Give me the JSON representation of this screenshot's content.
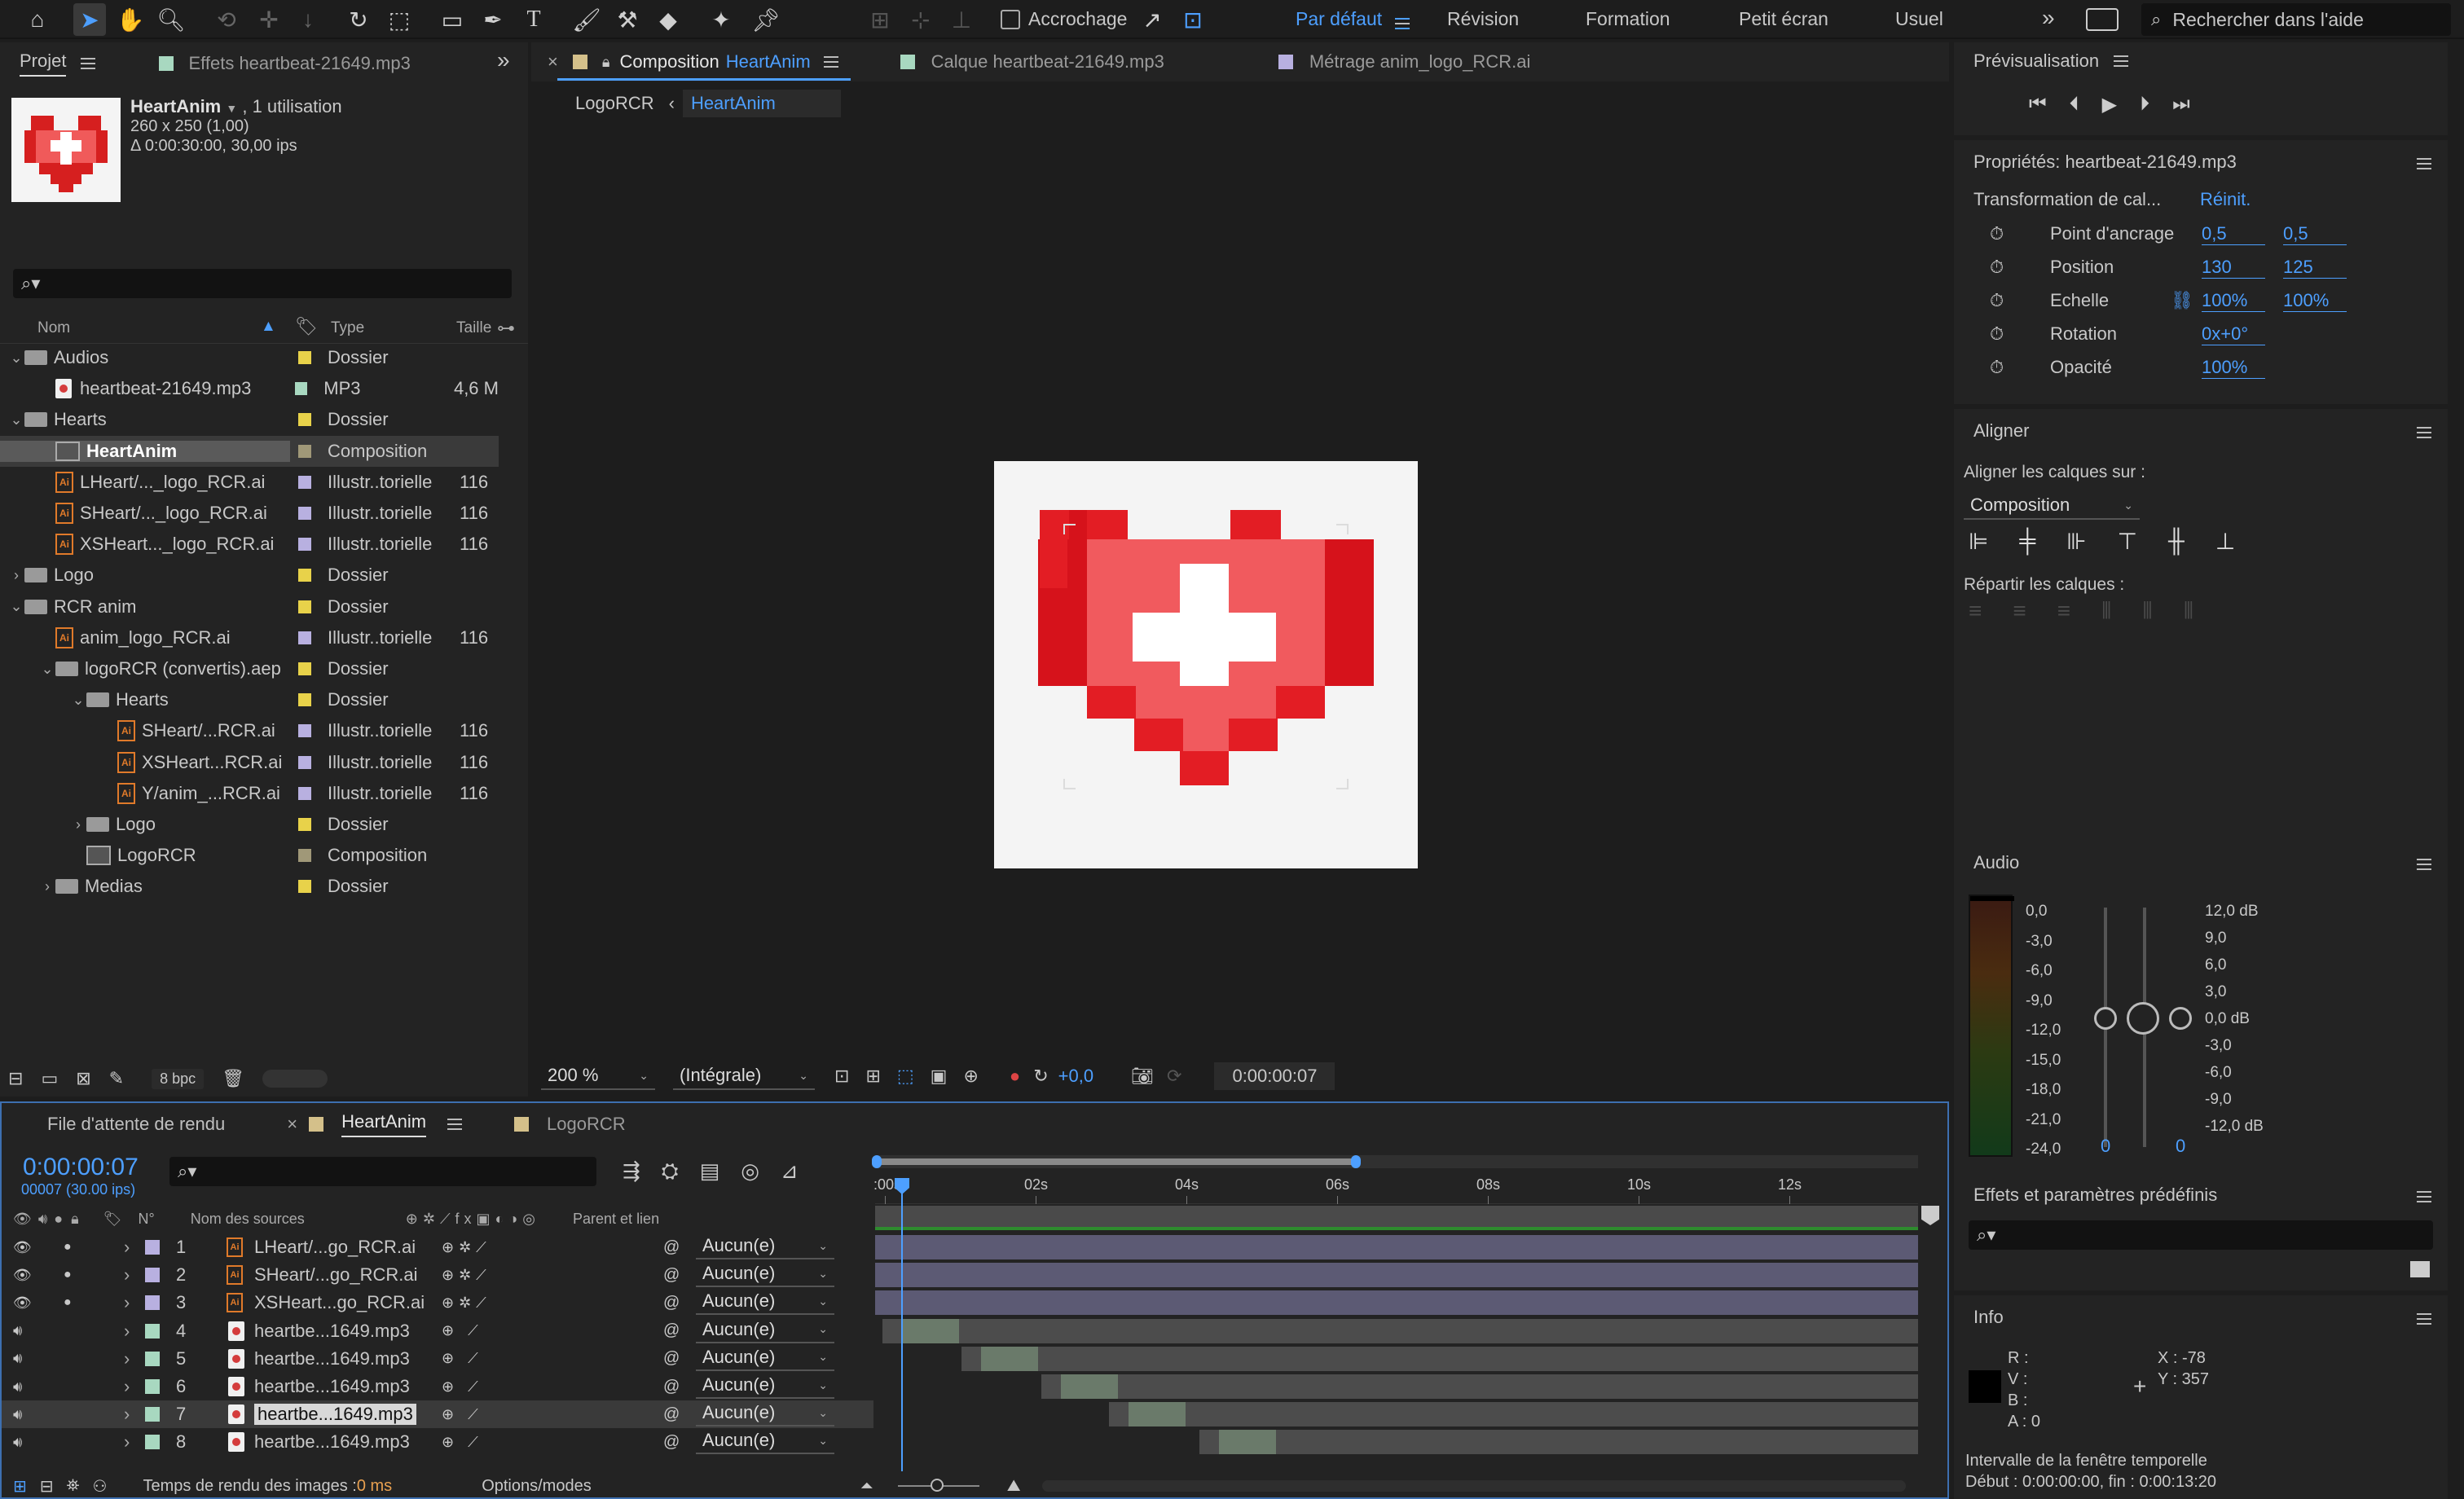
{
  "toolbar": {
    "snapping_label": "Accrochage",
    "workspaces": [
      "Par défaut",
      "Révision",
      "Formation",
      "Petit écran",
      "Usuel"
    ],
    "search_placeholder": "Rechercher dans l'aide"
  },
  "project": {
    "tab_project": "Projet",
    "tab_effects": "Effets heartbeat-21649.mp3",
    "selected_name": "HeartAnim",
    "selected_usage": ", 1 utilisation",
    "selected_size": "260 x 250 (1,00)",
    "selected_duration": "Δ 0:00:30:00, 30,00 ips",
    "col_name": "Nom",
    "col_type": "Type",
    "col_size": "Taille",
    "items": [
      {
        "name": "Audios",
        "type": "Dossier",
        "size": "",
        "kind": "folder",
        "indent": 0,
        "chev": "v"
      },
      {
        "name": "heartbeat-21649.mp3",
        "type": "MP3",
        "size": "4,6 M",
        "kind": "mp3",
        "indent": 1,
        "chev": ""
      },
      {
        "name": "Hearts",
        "type": "Dossier",
        "size": "",
        "kind": "folder",
        "indent": 0,
        "chev": "v"
      },
      {
        "name": "HeartAnim",
        "type": "Composition",
        "size": "",
        "kind": "comp",
        "indent": 1,
        "chev": ""
      },
      {
        "name": "LHeart/..._logo_RCR.ai",
        "type": "Illustr..torielle",
        "size": "116",
        "kind": "ai",
        "indent": 1,
        "chev": ""
      },
      {
        "name": "SHeart/..._logo_RCR.ai",
        "type": "Illustr..torielle",
        "size": "116",
        "kind": "ai",
        "indent": 1,
        "chev": ""
      },
      {
        "name": "XSHeart..._logo_RCR.ai",
        "type": "Illustr..torielle",
        "size": "116",
        "kind": "ai",
        "indent": 1,
        "chev": ""
      },
      {
        "name": "Logo",
        "type": "Dossier",
        "size": "",
        "kind": "folder",
        "indent": 0,
        "chev": ">"
      },
      {
        "name": "RCR anim",
        "type": "Dossier",
        "size": "",
        "kind": "folder",
        "indent": 0,
        "chev": "v"
      },
      {
        "name": "anim_logo_RCR.ai",
        "type": "Illustr..torielle",
        "size": "116",
        "kind": "ai",
        "indent": 1,
        "chev": ""
      },
      {
        "name": "logoRCR (convertis).aep",
        "type": "Dossier",
        "size": "",
        "kind": "folder",
        "indent": 1,
        "chev": "v"
      },
      {
        "name": "Hearts",
        "type": "Dossier",
        "size": "",
        "kind": "folder",
        "indent": 2,
        "chev": "v"
      },
      {
        "name": "SHeart/...RCR.ai",
        "type": "Illustr..torielle",
        "size": "116",
        "kind": "ai",
        "indent": 3,
        "chev": ""
      },
      {
        "name": "XSHeart...RCR.ai",
        "type": "Illustr..torielle",
        "size": "116",
        "kind": "ai",
        "indent": 3,
        "chev": ""
      },
      {
        "name": "Y/anim_...RCR.ai",
        "type": "Illustr..torielle",
        "size": "116",
        "kind": "ai",
        "indent": 3,
        "chev": ""
      },
      {
        "name": "Logo",
        "type": "Dossier",
        "size": "",
        "kind": "folder",
        "indent": 2,
        "chev": ">"
      },
      {
        "name": "LogoRCR",
        "type": "Composition",
        "size": "",
        "kind": "comp",
        "indent": 2,
        "chev": ""
      },
      {
        "name": "Medias",
        "type": "Dossier",
        "size": "",
        "kind": "folder",
        "indent": 1,
        "chev": ">"
      }
    ],
    "bpc": "8 bpc"
  },
  "viewer": {
    "tab_comp_prefix": "Composition",
    "tab_comp_name": "HeartAnim",
    "tab_layer": "Calque heartbeat-21649.mp3",
    "tab_footage": "Métrage anim_logo_RCR.ai",
    "crumb_parent": "LogoRCR",
    "crumb_current": "HeartAnim",
    "zoom": "200 %",
    "resolution": "(Intégrale)",
    "exposure": "+0,0",
    "timecode": "0:00:00:07"
  },
  "preview": {
    "title": "Prévisualisation"
  },
  "properties": {
    "title": "Propriétés: heartbeat-21649.mp3",
    "section": "Transformation de cal...",
    "reset": "Réinit.",
    "rows": [
      {
        "label": "Point d'ancrage",
        "v1": "0,5",
        "v2": "0,5"
      },
      {
        "label": "Position",
        "v1": "130",
        "v2": "125"
      },
      {
        "label": "Echelle",
        "v1": "100%",
        "v2": "100%"
      },
      {
        "label": "Rotation",
        "v1": "0x+0°",
        "v2": ""
      },
      {
        "label": "Opacité",
        "v1": "100%",
        "v2": ""
      }
    ]
  },
  "align": {
    "title": "Aligner",
    "align_to_label": "Aligner les calques sur :",
    "align_to_value": "Composition",
    "distribute_label": "Répartir les calques :"
  },
  "audio": {
    "title": "Audio",
    "left_scale": [
      "0,0",
      "-3,0",
      "-6,0",
      "-9,0",
      "-12,0",
      "-15,0",
      "-18,0",
      "-21,0",
      "-24,0"
    ],
    "right_scale": [
      "12,0 dB",
      "9,0",
      "6,0",
      "3,0",
      "0,0 dB",
      "-3,0",
      "-6,0",
      "-9,0",
      "-12,0 dB"
    ],
    "left_value": "0",
    "right_value": "0"
  },
  "effects": {
    "title": "Effets et paramètres prédéfinis"
  },
  "info": {
    "title": "Info",
    "r": "R :",
    "v": "V :",
    "b": "B :",
    "a": "A :  0",
    "x": "X :  -78",
    "y": "Y :  357",
    "interval_label": "Intervalle de la fenêtre temporelle",
    "interval_value": "Début : 0:00:00:00, fin : 0:00:13:20"
  },
  "timeline": {
    "tab_render": "File d'attente de rendu",
    "tab_heart": "HeartAnim",
    "tab_logo": "LogoRCR",
    "timecode": "0:00:00:07",
    "frames": "00007 (30.00 ips)",
    "col_num": "N°",
    "col_source": "Nom des sources",
    "col_parent": "Parent et lien",
    "ruler": [
      ":00s",
      "02s",
      "04s",
      "06s",
      "08s",
      "10s",
      "12s"
    ],
    "layers": [
      {
        "num": "1",
        "name": "LHeart/...go_RCR.ai",
        "parent": "Aucun(e)",
        "kind": "ai",
        "start": 0.0,
        "end": 14.0
      },
      {
        "num": "2",
        "name": "SHeart/...go_RCR.ai",
        "parent": "Aucun(e)",
        "kind": "ai",
        "start": 0.0,
        "end": 14.0
      },
      {
        "num": "3",
        "name": "XSHeart...go_RCR.ai",
        "parent": "Aucun(e)",
        "kind": "ai",
        "start": 0.0,
        "end": 14.0
      },
      {
        "num": "4",
        "name": "heartbe...1649.mp3",
        "parent": "Aucun(e)",
        "kind": "mp3",
        "start": 0.1,
        "end": 14.0
      },
      {
        "num": "5",
        "name": "heartbe...1649.mp3",
        "parent": "Aucun(e)",
        "kind": "mp3",
        "start": 1.15,
        "end": 14.0
      },
      {
        "num": "6",
        "name": "heartbe...1649.mp3",
        "parent": "Aucun(e)",
        "kind": "mp3",
        "start": 2.2,
        "end": 14.0
      },
      {
        "num": "7",
        "name": "heartbe...1649.mp3",
        "parent": "Aucun(e)",
        "kind": "mp3",
        "start": 3.1,
        "end": 14.0
      },
      {
        "num": "8",
        "name": "heartbe...1649.mp3",
        "parent": "Aucun(e)",
        "kind": "mp3",
        "start": 4.3,
        "end": 14.0
      }
    ],
    "render_time_label": "Temps de rendu des images : ",
    "render_time_value": "0 ms",
    "options_modes": "Options/modes"
  }
}
